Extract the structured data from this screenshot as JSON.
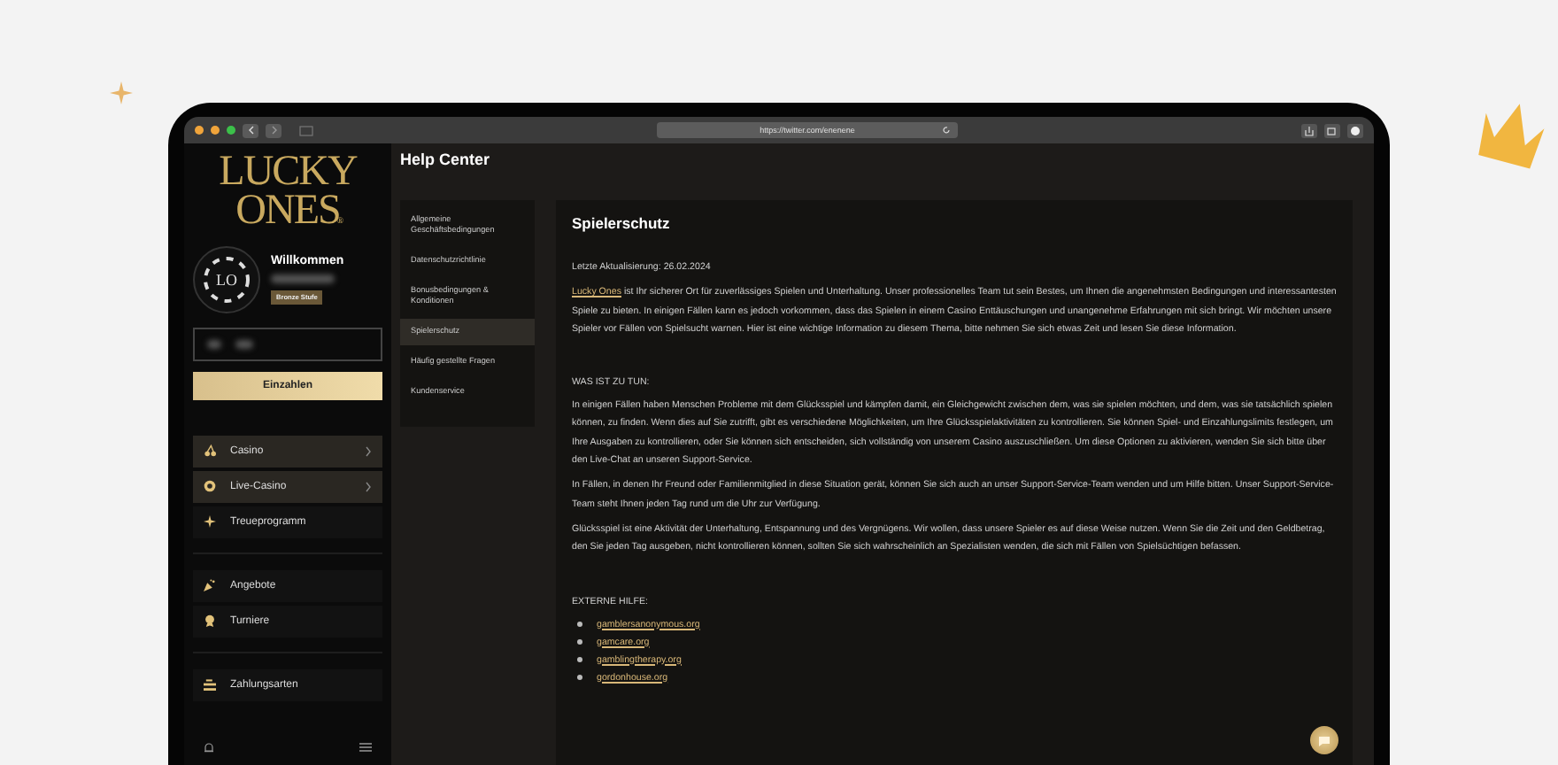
{
  "browser": {
    "url": "https://twitter.com/enenene"
  },
  "sidebar": {
    "logo": {
      "line_1": "LUCKY",
      "line_2": "ONES",
      "mark": "®"
    },
    "avatar": {
      "initials": "LO"
    },
    "welcome": "Willkommen",
    "level_badge": "Bronze Stufe",
    "deposit_button": "Einzahlen",
    "menu_groups": [
      [
        {
          "label": "Casino",
          "kind": "expandable"
        },
        {
          "label": "Live-Casino",
          "kind": "expandable"
        },
        {
          "label": "Treueprogramm",
          "kind": "plain"
        }
      ],
      [
        {
          "label": "Angebote",
          "kind": "plain"
        },
        {
          "label": "Turniere",
          "kind": "plain"
        }
      ],
      [
        {
          "label": "Zahlungsarten",
          "kind": "plain"
        }
      ]
    ]
  },
  "page_title": "Help Center",
  "help_nav": [
    {
      "label": "Allgemeine Geschäftsbedingungen",
      "selected": false
    },
    {
      "label": "Datenschutzrichtlinie",
      "selected": false
    },
    {
      "label": "Bonusbedingungen & Konditionen",
      "selected": false
    },
    {
      "label": "Spielerschutz",
      "selected": true
    },
    {
      "label": "Häufig gestellte Fragen",
      "selected": false
    },
    {
      "label": "Kundenservice",
      "selected": false
    }
  ],
  "article": {
    "title": "Spielerschutz",
    "updated": "Letzte Aktualisierung: 26.02.2024",
    "blocks": [
      {
        "kind": "paragraph",
        "link": "Lucky Ones",
        "text": " ist Ihr sicherer Ort für zuverlässiges Spielen und Unterhaltung. Unser professionelles Team tut sein Bestes, um Ihnen die angenehmsten Bedingungen und interessantesten Spiele zu bieten. In einigen Fällen kann es jedoch vorkommen, dass das Spielen in einem Casino Enttäuschungen und unangenehme Erfahrungen mit sich bringt. Wir möchten unsere Spieler vor Fällen von Spielsucht warnen. Hier ist eine wichtige Information zu diesem Thema, bitte nehmen Sie sich etwas Zeit und lesen Sie diese Information."
      },
      {
        "kind": "heading",
        "text": "WAS IST ZU TUN:"
      },
      {
        "kind": "paragraph",
        "text": "In einigen Fällen haben Menschen Probleme mit dem Glücksspiel und kämpfen damit, ein Gleichgewicht zwischen dem, was sie spielen möchten, und dem, was sie tatsächlich spielen können, zu finden. Wenn dies auf Sie zutrifft, gibt es verschiedene Möglichkeiten, um Ihre Glücksspielaktivitäten zu kontrollieren. Sie können Spiel- und Einzahlungslimits festlegen, um Ihre Ausgaben zu kontrollieren, oder Sie können sich entscheiden, sich vollständig von unserem Casino auszuschließen. Um diese Optionen zu aktivieren, wenden Sie sich bitte über den Live-Chat an unseren Support-Service."
      },
      {
        "kind": "paragraph",
        "text": "In Fällen, in denen Ihr Freund oder Familienmitglied in diese Situation gerät, können Sie sich auch an unser Support-Service-Team wenden und um Hilfe bitten. Unser Support-Service-Team steht Ihnen jeden Tag rund um die Uhr zur Verfügung."
      },
      {
        "kind": "paragraph",
        "text": "Glücksspiel ist eine Aktivität der Unterhaltung, Entspannung und des Vergnügens. Wir wollen, dass unsere Spieler es auf diese Weise nutzen. Wenn Sie die Zeit und den Geldbetrag, den Sie jeden Tag ausgeben, nicht kontrollieren können, sollten Sie sich wahrscheinlich an Spezialisten wenden, die sich mit Fällen von Spielsüchtigen befassen."
      },
      {
        "kind": "heading",
        "text": "EXTERNE HILFE:"
      },
      {
        "kind": "links",
        "items": [
          "gamblersanonymous.org",
          "gamcare.org",
          "gamblingtherapy.org",
          "gordonhouse.org"
        ]
      }
    ]
  }
}
